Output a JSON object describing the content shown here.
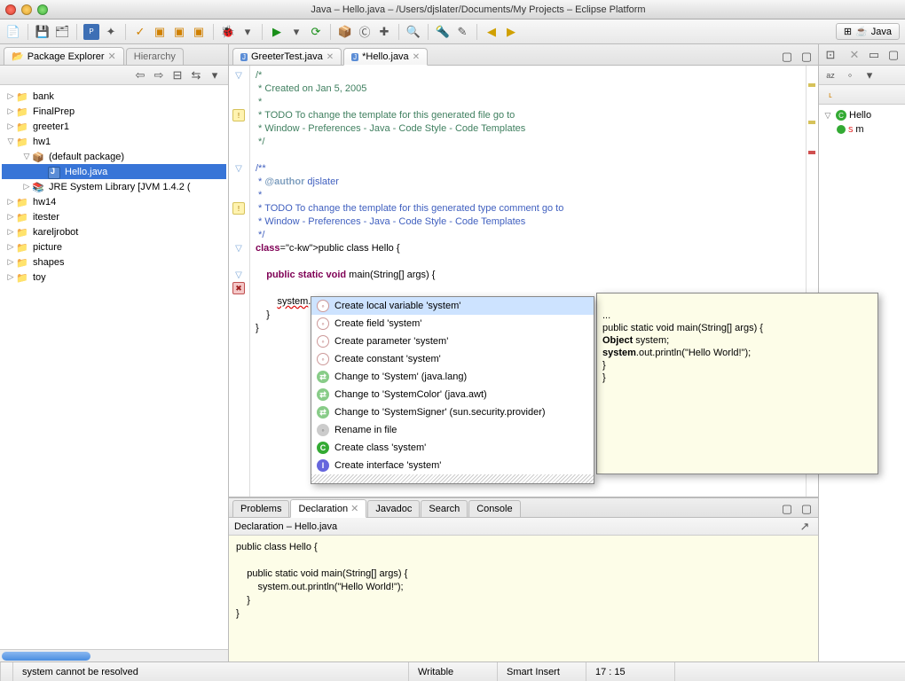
{
  "window": {
    "title": "Java – Hello.java – /Users/djslater/Documents/My Projects – Eclipse Platform"
  },
  "perspective": {
    "label": "Java"
  },
  "package_explorer": {
    "tab_label": "Package Explorer",
    "hierarchy_tab": "Hierarchy",
    "items": [
      {
        "label": "bank",
        "exp": false,
        "depth": 0,
        "kind": "folder"
      },
      {
        "label": "FinalPrep",
        "exp": false,
        "depth": 0,
        "kind": "folder"
      },
      {
        "label": "greeter1",
        "exp": false,
        "depth": 0,
        "kind": "folder"
      },
      {
        "label": "hw1",
        "exp": true,
        "depth": 0,
        "kind": "folder"
      },
      {
        "label": "(default package)",
        "exp": true,
        "depth": 1,
        "kind": "pkg"
      },
      {
        "label": "Hello.java",
        "exp": false,
        "depth": 2,
        "kind": "java",
        "sel": true
      },
      {
        "label": "JRE System Library [JVM 1.4.2 (",
        "exp": false,
        "depth": 1,
        "kind": "lib"
      },
      {
        "label": "hw14",
        "exp": false,
        "depth": 0,
        "kind": "folder"
      },
      {
        "label": "itester",
        "exp": false,
        "depth": 0,
        "kind": "folder"
      },
      {
        "label": "kareljrobot",
        "exp": false,
        "depth": 0,
        "kind": "folder"
      },
      {
        "label": "picture",
        "exp": false,
        "depth": 0,
        "kind": "folder"
      },
      {
        "label": "shapes",
        "exp": false,
        "depth": 0,
        "kind": "folder"
      },
      {
        "label": "toy",
        "exp": false,
        "depth": 0,
        "kind": "folder"
      }
    ]
  },
  "editor": {
    "tabs": [
      {
        "label": "GreeterTest.java",
        "active": false
      },
      {
        "label": "*Hello.java",
        "active": true
      }
    ],
    "lines": [
      {
        "t": "/*",
        "cls": "c-comment",
        "fold": "▽"
      },
      {
        "t": " * Created on Jan 5, 2005",
        "cls": "c-comment"
      },
      {
        "t": " *",
        "cls": "c-comment"
      },
      {
        "t": " * TODO To change the template for this generated file go to",
        "cls": "c-comment",
        "mark": "warn"
      },
      {
        "t": " * Window - Preferences - Java - Code Style - Code Templates",
        "cls": "c-comment"
      },
      {
        "t": " */",
        "cls": "c-comment"
      },
      {
        "t": ""
      },
      {
        "t": "/**",
        "cls": "c-jdoc",
        "fold": "▽"
      },
      {
        "t": " * @author djslater",
        "cls": "c-jdoc",
        "tag": "@author"
      },
      {
        "t": " *",
        "cls": "c-jdoc"
      },
      {
        "t": " * TODO To change the template for this generated type comment go to",
        "cls": "c-jdoc",
        "mark": "warn"
      },
      {
        "t": " * Window - Preferences - Java - Code Style - Code Templates",
        "cls": "c-jdoc"
      },
      {
        "t": " */",
        "cls": "c-jdoc"
      },
      {
        "t": "public class Hello {",
        "kw": [
          "public",
          "class"
        ],
        "fold": "▽"
      },
      {
        "t": ""
      },
      {
        "t": "    public static void main(String[] args) {",
        "kw": [
          "public",
          "static",
          "void"
        ],
        "fold": "▽"
      },
      {
        "t": "        system.out.println(\"Hello World!\");",
        "mark": "err",
        "hl": true,
        "err": "system",
        "str": "\"Hello World!\""
      },
      {
        "t": "    }"
      },
      {
        "t": "}"
      }
    ]
  },
  "quickfix": {
    "items": [
      {
        "label": "Create local variable 'system'",
        "kind": "local",
        "sel": true
      },
      {
        "label": "Create field 'system'",
        "kind": "local"
      },
      {
        "label": "Create parameter 'system'",
        "kind": "local"
      },
      {
        "label": "Create constant 'system'",
        "kind": "local"
      },
      {
        "label": "Change to 'System' (java.lang)",
        "kind": "change"
      },
      {
        "label": "Change to 'SystemColor' (java.awt)",
        "kind": "change"
      },
      {
        "label": "Change to 'SystemSigner' (sun.security.provider)",
        "kind": "change"
      },
      {
        "label": "Rename in file",
        "kind": "gray"
      },
      {
        "label": "Create class 'system'",
        "kind": "class"
      },
      {
        "label": "Create interface 'system'",
        "kind": "iface"
      }
    ]
  },
  "preview": {
    "l1": "...",
    "l2a": "public static void main(String[] args) {",
    "l3a": "Object",
    " l3b": " system;",
    "l4a": "system",
    "l4b": ".out.println(\"Hello World!\");",
    "l5": "}",
    "l6": "}"
  },
  "outline": {
    "root": "Hello",
    "method_suffix": "m"
  },
  "bottom": {
    "tabs": [
      "Problems",
      "Declaration",
      "Javadoc",
      "Search",
      "Console"
    ],
    "active": 1,
    "header": "Declaration – Hello.java",
    "code_lines": [
      "public class Hello {",
      "",
      "    public static void main(String[] args) {",
      "        system.out.println(\"Hello World!\");",
      "    }",
      "}"
    ]
  },
  "status": {
    "msg": "system cannot be resolved",
    "writable": "Writable",
    "insert": "Smart Insert",
    "pos": "17 : 15"
  }
}
